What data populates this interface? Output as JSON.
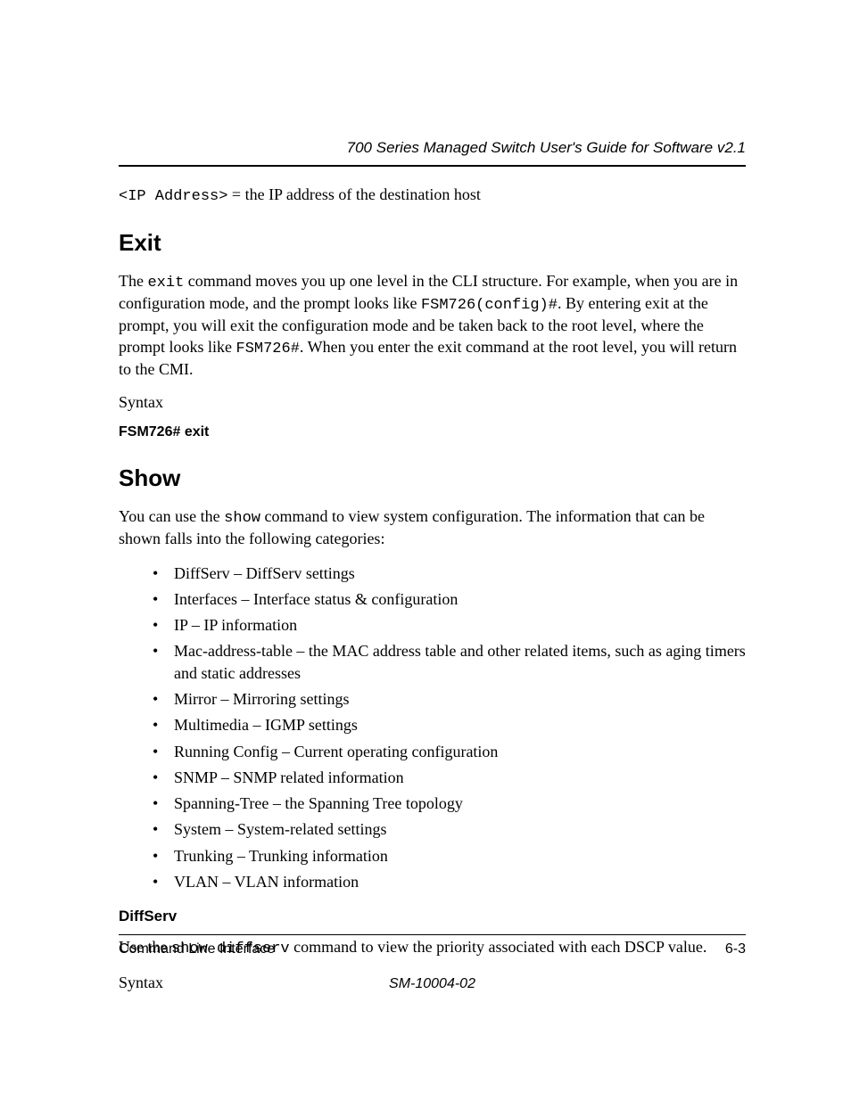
{
  "header": {
    "doc_title": "700 Series Managed Switch User's Guide for Software v2.1"
  },
  "ip_line": {
    "code": "<IP Address>",
    "desc": " = the IP address of the destination host"
  },
  "exit": {
    "heading": "Exit",
    "p1_a": "The ",
    "p1_code1": "exit",
    "p1_b": " command moves you up one level in the CLI structure. For example, when you are in configuration mode, and the prompt looks like ",
    "p1_code2": "FSM726(config)#",
    "p1_c": ". By entering exit at the prompt, you will exit the configuration mode and be taken back to the root level, where the prompt looks like ",
    "p1_code3": "FSM726#",
    "p1_d": ". When you enter the exit command at the root level, you will return to the CMI.",
    "syntax_label": "Syntax",
    "syntax_cmd": "FSM726# exit"
  },
  "show": {
    "heading": "Show",
    "p1_a": "You can use the ",
    "p1_code1": "show",
    "p1_b": " command to view system configuration. The information that can be shown falls into the following categories:",
    "items": [
      "DiffServ – DiffServ settings",
      "Interfaces – Interface status & configuration",
      "IP – IP information",
      "Mac-address-table – the MAC address table and other related items, such as aging timers and static addresses",
      "Mirror – Mirroring settings",
      "Multimedia – IGMP settings",
      "Running Config – Current operating configuration",
      "SNMP – SNMP related information",
      "Spanning-Tree – the Spanning Tree topology",
      "System – System-related settings",
      "Trunking – Trunking information",
      "VLAN – VLAN information"
    ]
  },
  "diffserv": {
    "heading": "DiffServ",
    "p1_a": "Use the ",
    "p1_code1": "show diffserv",
    "p1_b": " command to view the priority associated with each DSCP value.",
    "syntax_label": "Syntax"
  },
  "footer": {
    "left": "Command Line Interface",
    "right": "6-3",
    "center": "SM-10004-02"
  }
}
